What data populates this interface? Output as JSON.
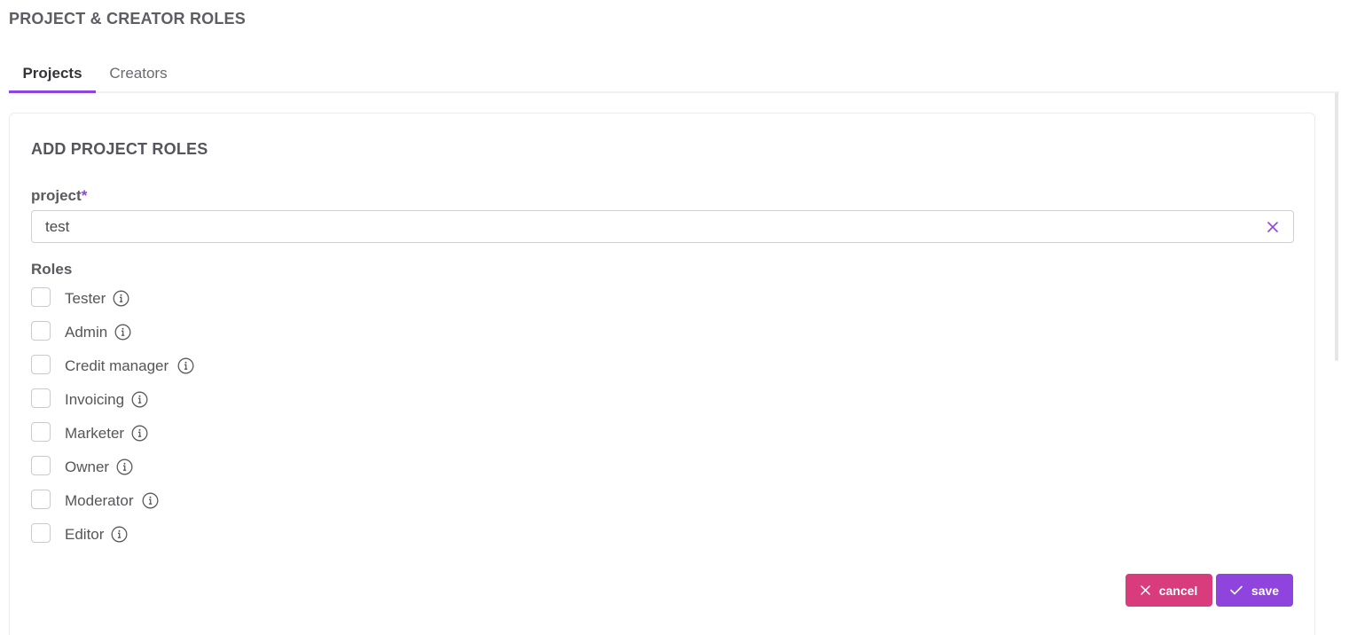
{
  "page": {
    "title": "PROJECT & CREATOR ROLES"
  },
  "tabs": [
    {
      "label": "Projects",
      "active": true
    },
    {
      "label": "Creators",
      "active": false
    }
  ],
  "form": {
    "title": "ADD PROJECT ROLES",
    "project_label": "project",
    "required_marker": "*",
    "project_value": "test",
    "roles_label": "Roles",
    "roles": [
      {
        "label": "Tester",
        "checked": false
      },
      {
        "label": "Admin",
        "checked": false
      },
      {
        "label": "Credit manager",
        "checked": false
      },
      {
        "label": "Invoicing",
        "checked": false
      },
      {
        "label": "Marketer",
        "checked": false
      },
      {
        "label": "Owner",
        "checked": false
      },
      {
        "label": "Moderator",
        "checked": false
      },
      {
        "label": "Editor",
        "checked": false
      }
    ],
    "cancel_label": "cancel",
    "save_label": "save"
  },
  "colors": {
    "accent": "#8e44dd",
    "cancel": "#d83c7c"
  }
}
